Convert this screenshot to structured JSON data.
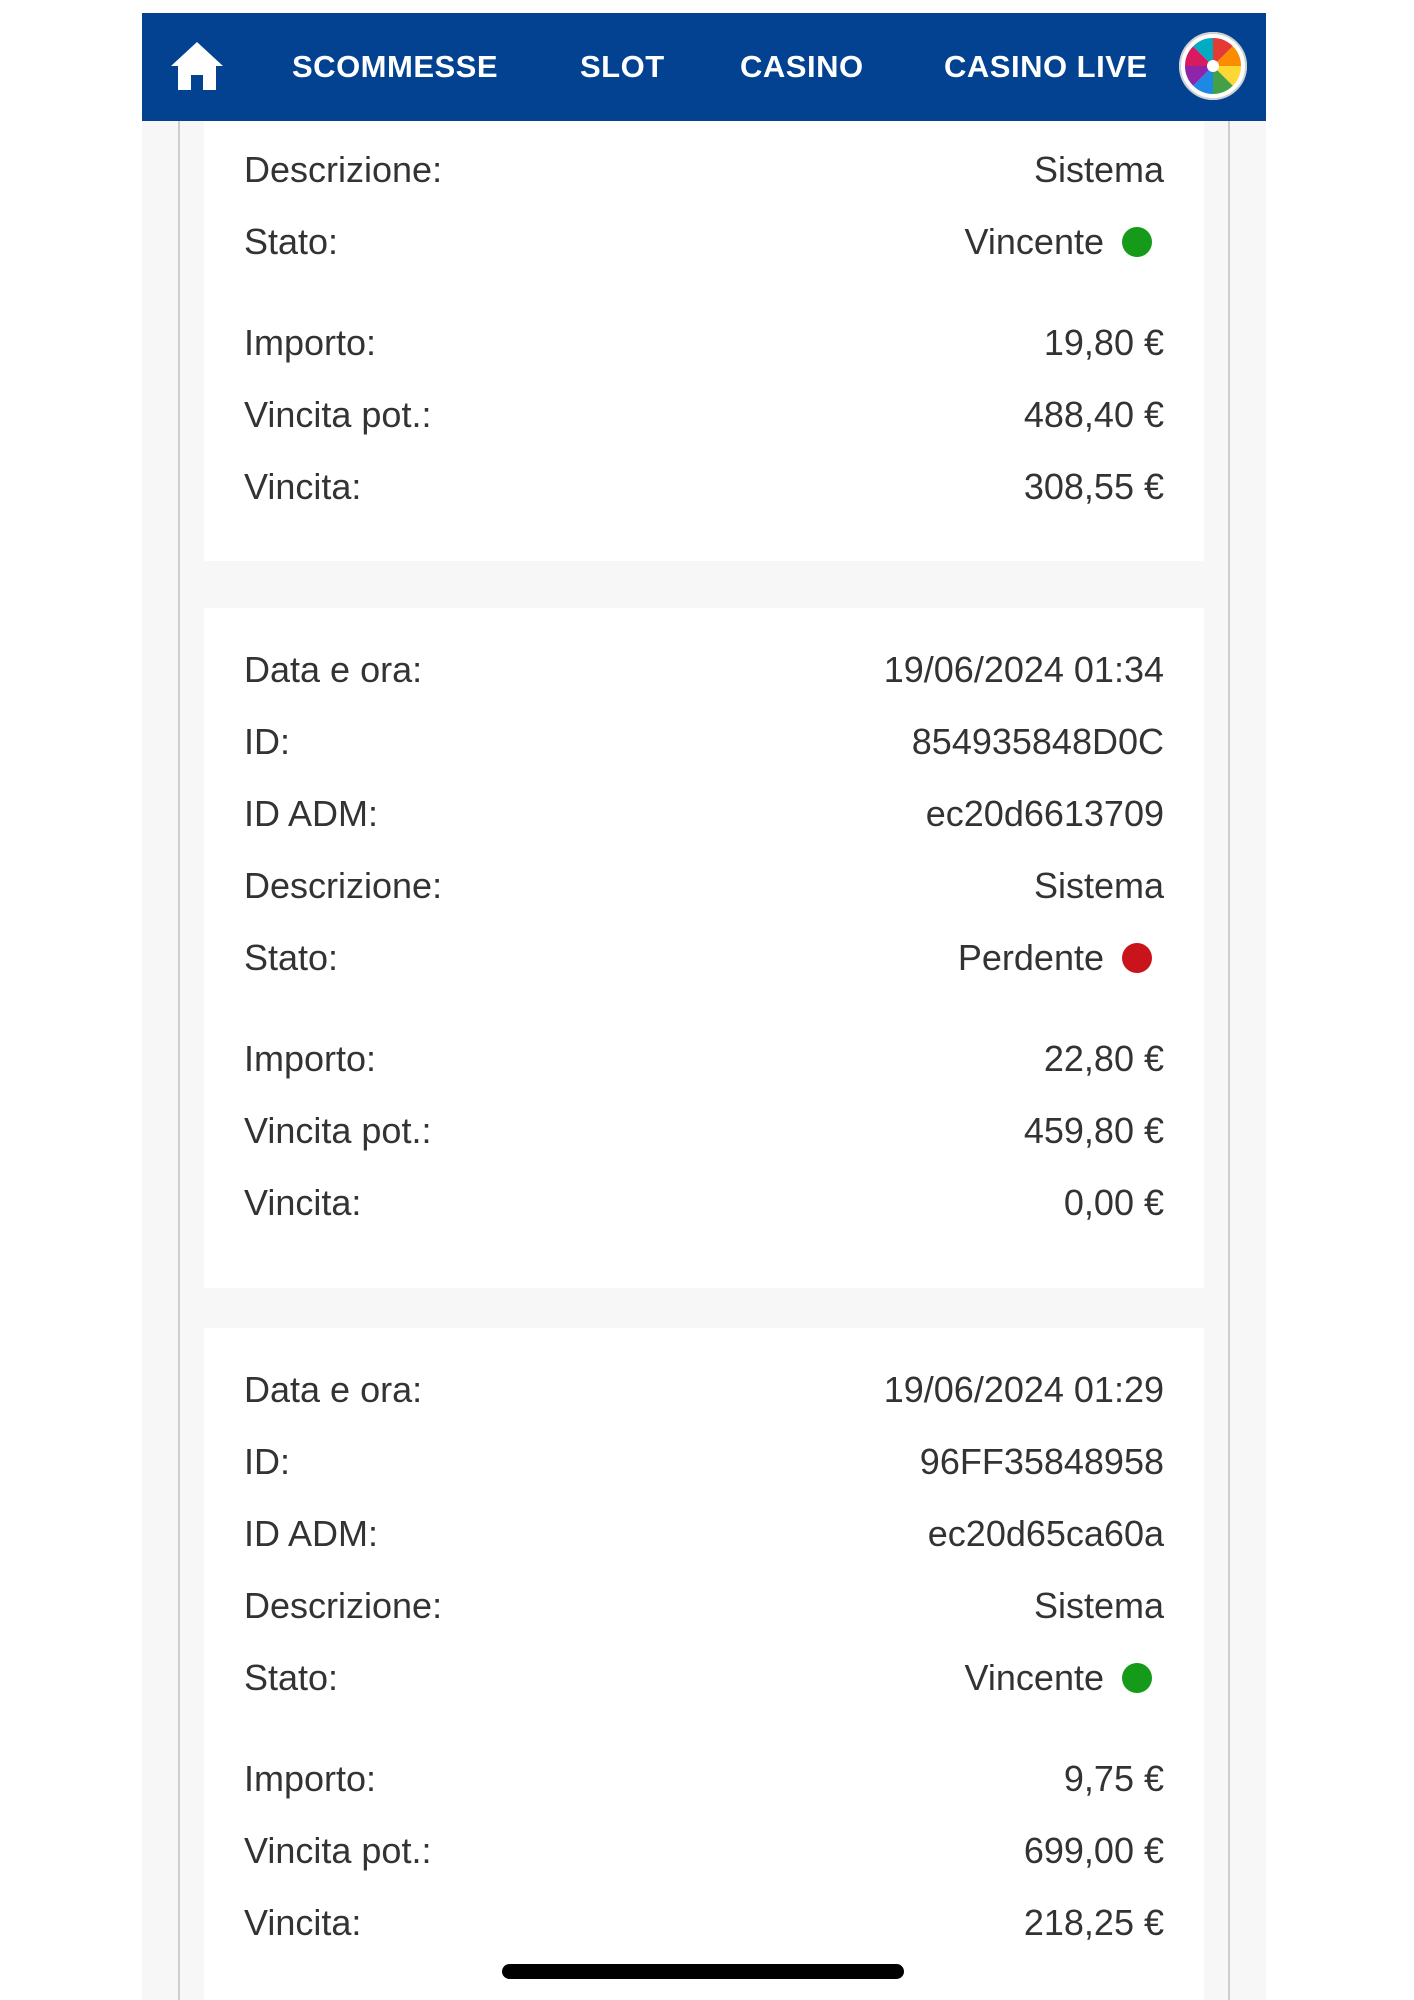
{
  "navbar": {
    "home_icon": "home-icon",
    "items": [
      "SCOMMESSE",
      "SLOT",
      "CASINO",
      "CASINO LIVE"
    ],
    "wheel_icon": "colorful-wheel-icon"
  },
  "colors": {
    "navbar_bg": "#024291",
    "win": "#159a1a",
    "lose": "#c8141a"
  },
  "cards": [
    {
      "rows": [
        {
          "label": "Descrizione:",
          "value": "Sistema"
        },
        {
          "label": "Stato:",
          "value": "Vincente",
          "status": "win"
        },
        {
          "label": "Importo:",
          "value": "19,80 €"
        },
        {
          "label": "Vincita pot.:",
          "value": "488,40 €"
        },
        {
          "label": "Vincita:",
          "value": "308,55 €"
        }
      ]
    },
    {
      "rows": [
        {
          "label": "Data e ora:",
          "value": "19/06/2024 01:34"
        },
        {
          "label": "ID:",
          "value": "854935848D0C"
        },
        {
          "label": "ID ADM:",
          "value": "ec20d6613709"
        },
        {
          "label": "Descrizione:",
          "value": "Sistema"
        },
        {
          "label": "Stato:",
          "value": "Perdente",
          "status": "lose"
        },
        {
          "label": "Importo:",
          "value": "22,80 €"
        },
        {
          "label": "Vincita pot.:",
          "value": "459,80 €"
        },
        {
          "label": "Vincita:",
          "value": "0,00 €"
        }
      ]
    },
    {
      "rows": [
        {
          "label": "Data e ora:",
          "value": "19/06/2024 01:29"
        },
        {
          "label": "ID:",
          "value": "96FF35848958"
        },
        {
          "label": "ID ADM:",
          "value": "ec20d65ca60a"
        },
        {
          "label": "Descrizione:",
          "value": "Sistema"
        },
        {
          "label": "Stato:",
          "value": "Vincente",
          "status": "win"
        },
        {
          "label": "Importo:",
          "value": "9,75 €"
        },
        {
          "label": "Vincita pot.:",
          "value": "699,00 €"
        },
        {
          "label": "Vincita:",
          "value": "218,25 €"
        }
      ]
    }
  ]
}
